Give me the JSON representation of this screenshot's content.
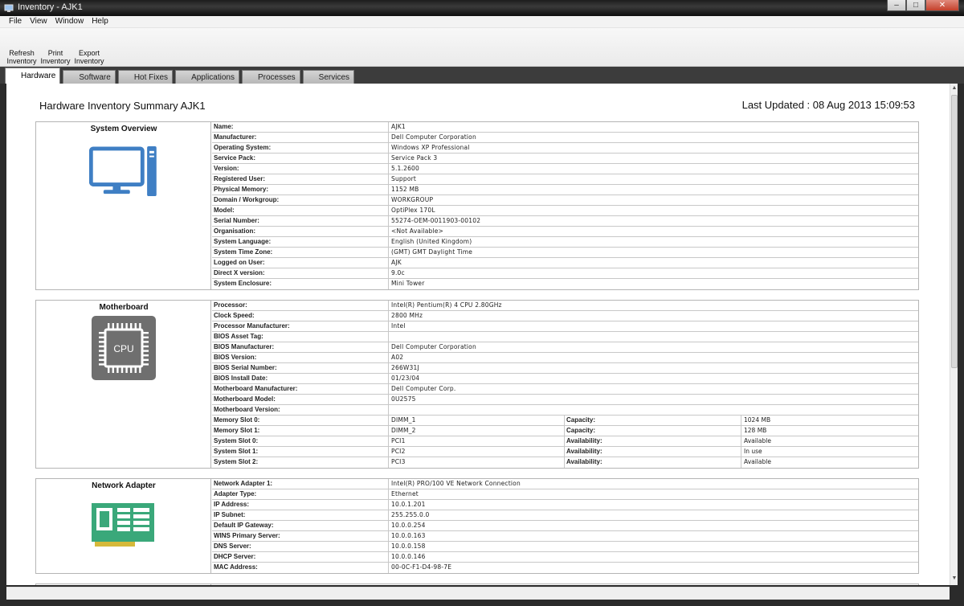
{
  "window": {
    "title": "Inventory - AJK1"
  },
  "menu": [
    "File",
    "View",
    "Window",
    "Help"
  ],
  "toolbar": [
    {
      "name": "refresh-inventory-button",
      "icon": "refresh-icon",
      "line1": "Refresh",
      "line2": "Inventory"
    },
    {
      "name": "print-inventory-button",
      "icon": "printer-icon",
      "line1": "Print",
      "line2": "Inventory"
    },
    {
      "name": "export-inventory-button",
      "icon": "export-icon",
      "line1": "Export",
      "line2": "Inventory"
    }
  ],
  "tabs": [
    {
      "label": "Hardware",
      "icon": "hardware-table-icon",
      "active": true
    },
    {
      "label": "Software",
      "icon": "software-globe-icon",
      "active": false
    },
    {
      "label": "Hot Fixes",
      "icon": "hotfix-star-icon",
      "active": false
    },
    {
      "label": "Applications",
      "icon": "applications-window-icon",
      "active": false
    },
    {
      "label": "Processes",
      "icon": "processes-window-icon",
      "active": false
    },
    {
      "label": "Services",
      "icon": "services-gear-icon",
      "active": false
    }
  ],
  "summary": {
    "title": "Hardware Inventory Summary AJK1",
    "last_updated": "Last Updated : 08 Aug 2013 15:09:53"
  },
  "sections": [
    {
      "title": "System Overview",
      "icon": "computer-monitor-icon",
      "rows": [
        {
          "k": "Name:",
          "v": "AJK1"
        },
        {
          "k": "Manufacturer:",
          "v": "Dell Computer Corporation"
        },
        {
          "k": "Operating System:",
          "v": "Windows XP Professional"
        },
        {
          "k": "Service Pack:",
          "v": "Service Pack 3"
        },
        {
          "k": "Version:",
          "v": "5.1.2600"
        },
        {
          "k": "Registered User:",
          "v": "Support"
        },
        {
          "k": "Physical Memory:",
          "v": "1152 MB"
        },
        {
          "k": "Domain / Workgroup:",
          "v": "WORKGROUP"
        },
        {
          "k": "Model:",
          "v": "OptiPlex 170L"
        },
        {
          "k": "Serial Number:",
          "v": "55274-OEM-0011903-00102"
        },
        {
          "k": "Organisation:",
          "v": "<Not Available>"
        },
        {
          "k": "System Language:",
          "v": "English (United Kingdom)"
        },
        {
          "k": "System Time Zone:",
          "v": "(GMT) GMT Daylight Time"
        },
        {
          "k": "Logged on User:",
          "v": "AJK"
        },
        {
          "k": "Direct X version:",
          "v": "9.0c"
        },
        {
          "k": "System Enclosure:",
          "v": "Mini Tower"
        }
      ]
    },
    {
      "title": "Motherboard",
      "icon": "cpu-chip-icon",
      "cpu_label": "CPU",
      "rows": [
        {
          "k": "Processor:",
          "v": "Intel(R) Pentium(R) 4 CPU 2.80GHz"
        },
        {
          "k": "Clock Speed:",
          "v": "2800 MHz"
        },
        {
          "k": "Processor Manufacturer:",
          "v": "Intel"
        },
        {
          "k": "BIOS Asset Tag:",
          "v": ""
        },
        {
          "k": "BIOS Manufacturer:",
          "v": "Dell Computer Corporation"
        },
        {
          "k": "BIOS Version:",
          "v": "A02"
        },
        {
          "k": "BIOS Serial Number:",
          "v": "266W31J"
        },
        {
          "k": "BIOS Install Date:",
          "v": "01/23/04"
        },
        {
          "k": "Motherboard Manufacturer:",
          "v": "Dell Computer Corp."
        },
        {
          "k": "Motherboard Model:",
          "v": "0U2575"
        },
        {
          "k": "Motherboard Version:",
          "v": ""
        },
        {
          "k": "Memory Slot 0:",
          "v": "DIMM_1",
          "k2": "Capacity:",
          "v2": "1024 MB"
        },
        {
          "k": "Memory Slot 1:",
          "v": "DIMM_2",
          "k2": "Capacity:",
          "v2": "128 MB"
        },
        {
          "k": "System Slot 0:",
          "v": "PCI1",
          "k2": "Availability:",
          "v2": "Available"
        },
        {
          "k": "System Slot 1:",
          "v": "PCI2",
          "k2": "Availability:",
          "v2": "In use"
        },
        {
          "k": "System Slot 2:",
          "v": "PCI3",
          "k2": "Availability:",
          "v2": "Available"
        }
      ]
    },
    {
      "title": "Network Adapter",
      "icon": "network-card-icon",
      "rows": [
        {
          "k": "Network Adapter 1:",
          "v": "Intel(R) PRO/100 VE Network Connection"
        },
        {
          "k": "Adapter Type:",
          "v": "Ethernet"
        },
        {
          "k": "IP Address:",
          "v": "10.0.1.201"
        },
        {
          "k": "IP Subnet:",
          "v": "255.255.0.0"
        },
        {
          "k": "Default IP Gateway:",
          "v": "10.0.0.254"
        },
        {
          "k": "WINS Primary Server:",
          "v": "10.0.0.163"
        },
        {
          "k": "DNS Server:",
          "v": "10.0.0.158"
        },
        {
          "k": "DHCP Server:",
          "v": "10.0.0.146"
        },
        {
          "k": "MAC Address:",
          "v": "00-0C-F1-D4-98-7E"
        }
      ]
    }
  ],
  "colors": {
    "monitor": "#3f7fc4",
    "cpu": "#6f6f6f",
    "nic": "#3aa87a",
    "nic_pins": "#d6b93a"
  }
}
